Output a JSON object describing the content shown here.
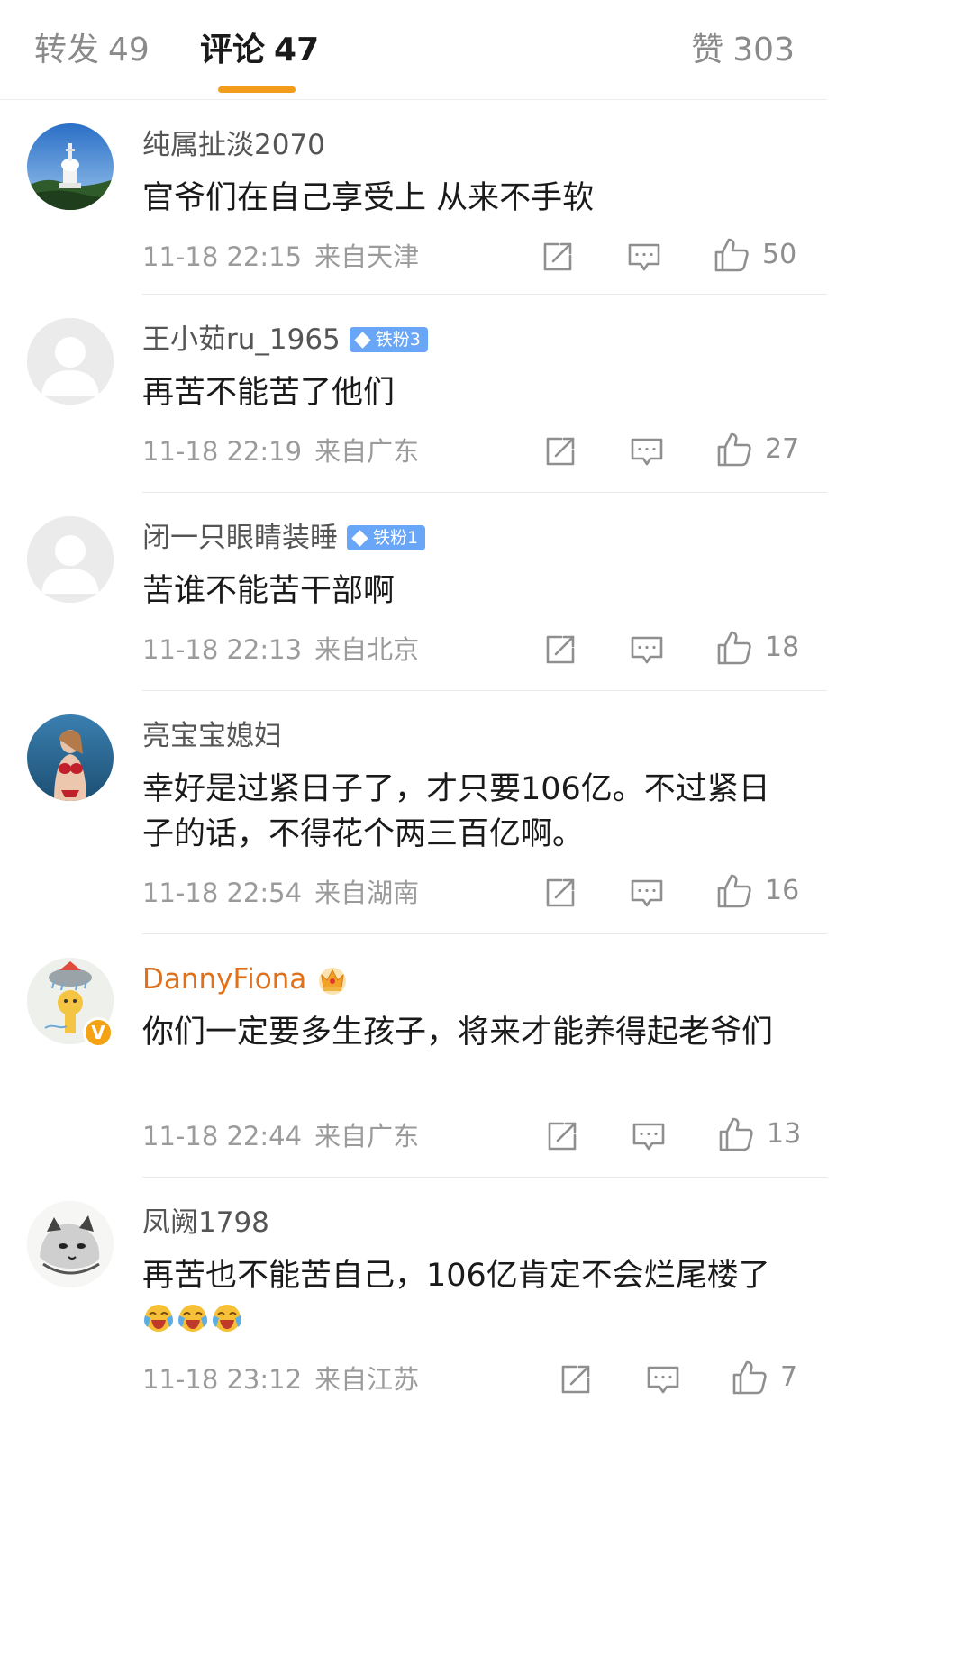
{
  "tabs": {
    "repost_label": "转发",
    "repost_count": "49",
    "comments_label": "评论",
    "comments_count": "47",
    "likes_label": "赞",
    "likes_count": "303",
    "active_color": "#f39c1b"
  },
  "comments": [
    {
      "username": "纯属扯淡2070",
      "text": "官爷们在自己享受上 从来不手软",
      "time": "11-18 22:15",
      "location": "来自天津",
      "likes": "50"
    },
    {
      "username": "王小茹ru_1965",
      "badge": "铁粉3",
      "text": "再苦不能苦了他们",
      "time": "11-18 22:19",
      "location": "来自广东",
      "likes": "27"
    },
    {
      "username": "闭一只眼睛装睡",
      "badge": "铁粉1",
      "text": "苦谁不能苦干部啊",
      "time": "11-18 22:13",
      "location": "来自北京",
      "likes": "18"
    },
    {
      "username": "亮宝宝媳妇",
      "text": "幸好是过紧日子了，才只要106亿。不过紧日子的话，不得花个两三百亿啊。",
      "time": "11-18 22:54",
      "location": "来自湖南",
      "likes": "16"
    },
    {
      "username": "DannyFiona",
      "text": "你们一定要多生孩子，将来才能养得起老爷们",
      "time": "11-18 22:44",
      "location": "来自广东",
      "likes": "13",
      "verified_mark": "V"
    },
    {
      "username": "凤阙1798",
      "text": "再苦也不能苦自己，106亿肯定不会烂尾楼了",
      "time": "11-18 23:12",
      "location": "来自江苏",
      "likes": "7"
    }
  ],
  "icons": {
    "share": "share-icon",
    "comment": "comment-icon",
    "like": "thumbs-up-icon"
  },
  "colors": {
    "vip_name": "#e0711a",
    "fan_badge": "#6aa6f7",
    "verified_badge": "#f3a313"
  }
}
